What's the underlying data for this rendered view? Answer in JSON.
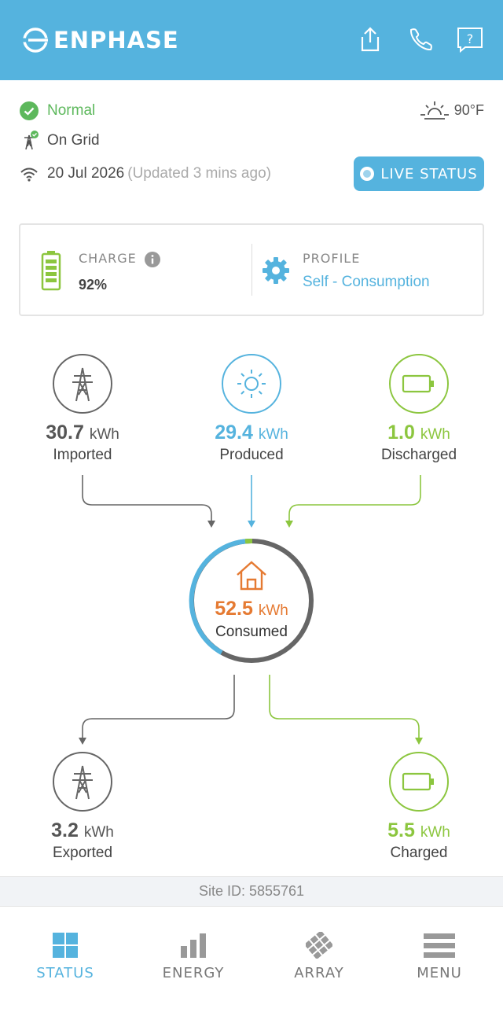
{
  "header": {
    "brand": "ENPHASE",
    "icons": [
      "share-icon",
      "phone-icon",
      "help-icon"
    ],
    "background_color": "#55B3DE"
  },
  "status": {
    "system_status": "Normal",
    "grid_status": "On Grid",
    "date": "20 Jul 2026",
    "updated": "(Updated 3 mins ago)",
    "temperature": "90°F",
    "live_status_label": "LIVE STATUS"
  },
  "card": {
    "charge_label": "CHARGE",
    "charge_value": "92%",
    "profile_label": "PROFILE",
    "profile_value": "Self - Consumption"
  },
  "flow": {
    "imported": {
      "value": "30.7",
      "unit": "kWh",
      "label": "Imported",
      "color": "#555555"
    },
    "produced": {
      "value": "29.4",
      "unit": "kWh",
      "label": "Produced",
      "color": "#55B3DE"
    },
    "discharged": {
      "value": "1.0",
      "unit": "kWh",
      "label": "Discharged",
      "color": "#8CC63F"
    },
    "consumed": {
      "value": "52.5",
      "unit": "kWh",
      "label": "Consumed",
      "color": "#E57A32"
    },
    "exported": {
      "value": "3.2",
      "unit": "kWh",
      "label": "Exported",
      "color": "#555555"
    },
    "charged": {
      "value": "5.5",
      "unit": "kWh",
      "label": "Charged",
      "color": "#8CC63F"
    },
    "consumed_ring_fraction": {
      "solar": 0.56,
      "battery": 0.02,
      "grid": 0.42
    }
  },
  "site": {
    "site_id": "Site ID: 5855761"
  },
  "nav": {
    "items": [
      {
        "label": "STATUS",
        "icon": "status-grid-icon",
        "active": true
      },
      {
        "label": "ENERGY",
        "icon": "energy-bars-icon",
        "active": false
      },
      {
        "label": "ARRAY",
        "icon": "array-panels-icon",
        "active": false
      },
      {
        "label": "MENU",
        "icon": "menu-icon",
        "active": false
      }
    ],
    "active_color": "#55B3DE",
    "inactive_color": "#777777"
  }
}
